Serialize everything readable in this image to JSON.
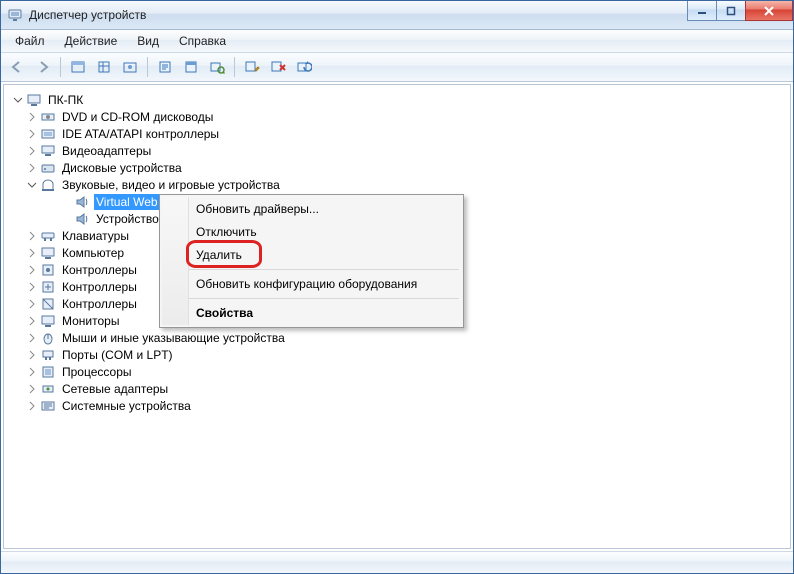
{
  "window": {
    "title": "Диспетчер устройств"
  },
  "menu": {
    "file": "Файл",
    "action": "Действие",
    "view": "Вид",
    "help": "Справка"
  },
  "tree": {
    "root": "ПК-ПК",
    "categories": [
      {
        "label": "DVD и CD-ROM дисководы"
      },
      {
        "label": "IDE ATA/ATAPI контроллеры"
      },
      {
        "label": "Видеоадаптеры"
      },
      {
        "label": "Дисковые устройства"
      },
      {
        "label": "Звуковые, видео и игровые устройства",
        "expanded": true,
        "children": [
          {
            "label": "Virtual Web"
          },
          {
            "label": "Устройство"
          }
        ]
      },
      {
        "label": "Клавиатуры"
      },
      {
        "label": "Компьютер"
      },
      {
        "label": "Контроллеры"
      },
      {
        "label": "Контроллеры"
      },
      {
        "label": "Контроллеры"
      },
      {
        "label": "Мониторы"
      },
      {
        "label": "Мыши и иные указывающие устройства"
      },
      {
        "label": "Порты (COM и LPT)"
      },
      {
        "label": "Процессоры"
      },
      {
        "label": "Сетевые адаптеры"
      },
      {
        "label": "Системные устройства"
      }
    ]
  },
  "context_menu": {
    "update_drivers": "Обновить драйверы...",
    "disable": "Отключить",
    "delete": "Удалить",
    "rescan": "Обновить конфигурацию оборудования",
    "properties": "Свойства"
  }
}
